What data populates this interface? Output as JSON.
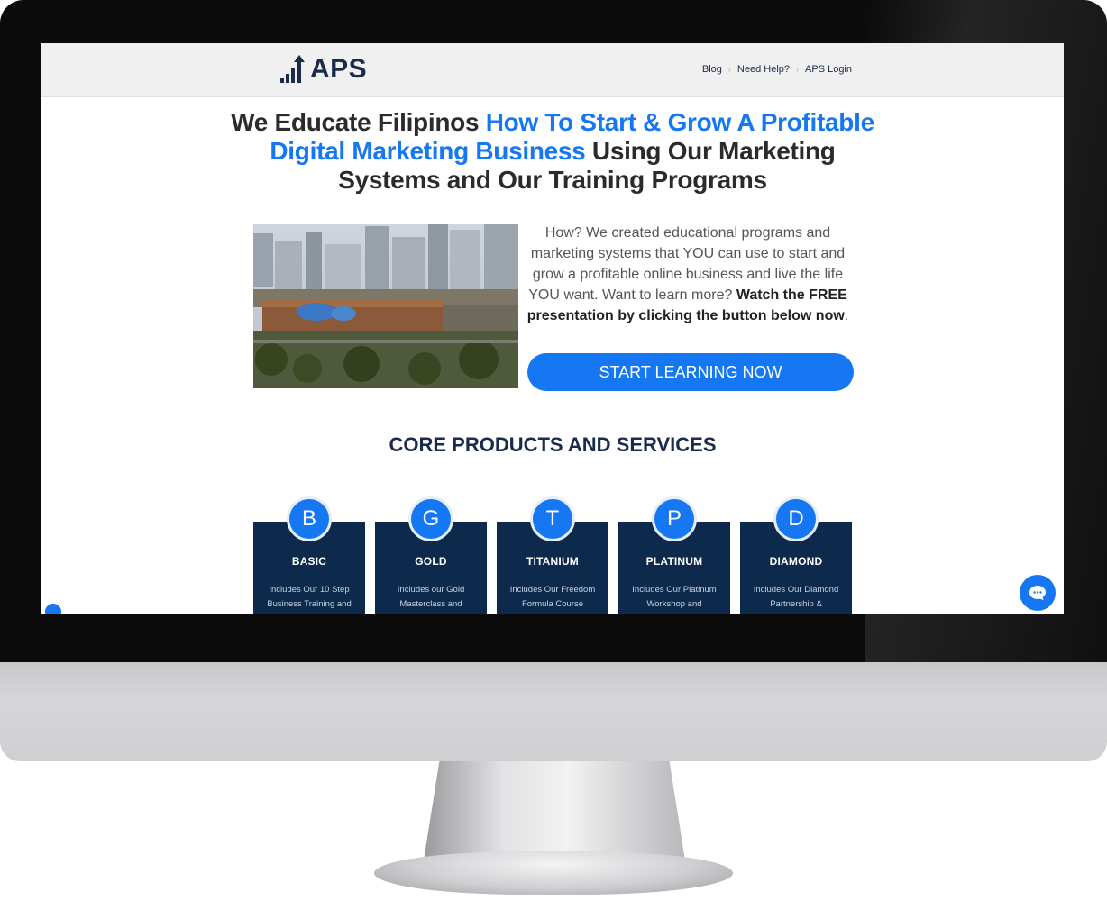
{
  "header": {
    "logo_text": "APS",
    "nav": [
      {
        "label": "Blog"
      },
      {
        "label": "Need Help?"
      },
      {
        "label": "APS Login"
      }
    ]
  },
  "hero": {
    "headline_part1": "We Educate Filipinos ",
    "headline_part2": "How To Start & Grow A Profitable Digital Marketing Business",
    "headline_part3": " Using Our Marketing Systems and  Our Training Programs",
    "intro_plain": "How? We created educational programs and marketing systems that YOU can use to start and grow a profitable online business and live the life YOU want. Want to learn more? ",
    "intro_bold": "Watch the FREE presentation by clicking the  button below now",
    "intro_end": ".",
    "cta_label": "START LEARNING NOW"
  },
  "products": {
    "title": "CORE PRODUCTS AND SERVICES",
    "items": [
      {
        "letter": "B",
        "name": "BASIC",
        "desc": "Includes Our 10 Step Business Training  and"
      },
      {
        "letter": "G",
        "name": "GOLD",
        "desc": "Includes our Gold Masterclass and"
      },
      {
        "letter": "T",
        "name": "TITANIUM",
        "desc": "Includes Our Freedom Formula Course"
      },
      {
        "letter": "P",
        "name": "PLATINUM",
        "desc": "Includes Our Platinum Workshop and"
      },
      {
        "letter": "D",
        "name": "DIAMOND",
        "desc": "Includes Our Diamond Partnership &"
      }
    ]
  },
  "colors": {
    "accent": "#1677f2",
    "navy": "#0d2a4d",
    "header_bg": "#f0f0f0"
  },
  "icons": {
    "logo_mark": "rising-bars-arrow-icon",
    "chat": "chat-bubble-icon",
    "accessibility": "accessibility-icon"
  }
}
